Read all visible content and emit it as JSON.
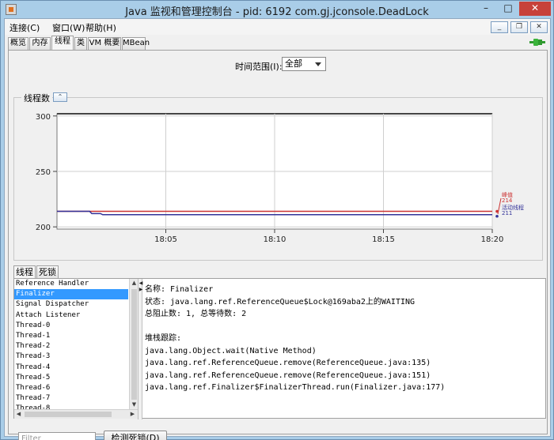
{
  "window": {
    "title": "Java 监视和管理控制台 - pid: 6192 com.gj.jconsole.DeadLock",
    "minimize": "–",
    "maximize": "□",
    "close": "✕"
  },
  "menu": {
    "connect": "连接(C)",
    "window": "窗口(W)",
    "help": "帮助(H)",
    "mdi_min": "_",
    "mdi_restore": "❐",
    "mdi_close": "✕"
  },
  "tabs": [
    "概览",
    "内存",
    "线程",
    "类",
    "VM 概要",
    "MBean"
  ],
  "time_range": {
    "label": "时间范围(I):",
    "value": "全部"
  },
  "chart_data": {
    "type": "line",
    "title": "线程数",
    "yticks": [
      200,
      250,
      300
    ],
    "ylim": [
      198,
      302
    ],
    "xticks": [
      "18:05",
      "18:10",
      "18:15",
      "18:20"
    ],
    "xlim": [
      0,
      20
    ],
    "xtick_positions": [
      5,
      10,
      15,
      20
    ],
    "grid": true,
    "series": [
      {
        "name": "峰值",
        "value_label": "214",
        "color": "#cc3333",
        "values": [
          [
            0,
            214
          ],
          [
            20,
            214
          ]
        ]
      },
      {
        "name": "活动线程",
        "value_label": "211",
        "color": "#333399",
        "values": [
          [
            0,
            214
          ],
          [
            1.5,
            214
          ],
          [
            1.6,
            212
          ],
          [
            2.0,
            212
          ],
          [
            2.1,
            211
          ],
          [
            20,
            211
          ]
        ]
      }
    ],
    "legend_position": "right"
  },
  "bottom_tabs": [
    "线程",
    "死锁"
  ],
  "threads": [
    "Reference Handler",
    "Finalizer",
    "Signal Dispatcher",
    "Attach Listener",
    "Thread-0",
    "Thread-1",
    "Thread-2",
    "Thread-3",
    "Thread-4",
    "Thread-5",
    "Thread-6",
    "Thread-7",
    "Thread-8"
  ],
  "selected_thread": 1,
  "details": {
    "name": "名称: Finalizer",
    "state": "状态: java.lang.ref.ReferenceQueue$Lock@169aba2上的WAITING",
    "counts": "总阻止数: 1, 总等待数: 2",
    "stack_header": "堆栈跟踪:",
    "stack": [
      "java.lang.Object.wait(Native Method)",
      "java.lang.ref.ReferenceQueue.remove(ReferenceQueue.java:135)",
      "java.lang.ref.ReferenceQueue.remove(ReferenceQueue.java:151)",
      "java.lang.ref.Finalizer$FinalizerThread.run(Finalizer.java:177)"
    ]
  },
  "filter_placeholder": "Filter",
  "detect_deadlock_label": "检测死锁(D)"
}
